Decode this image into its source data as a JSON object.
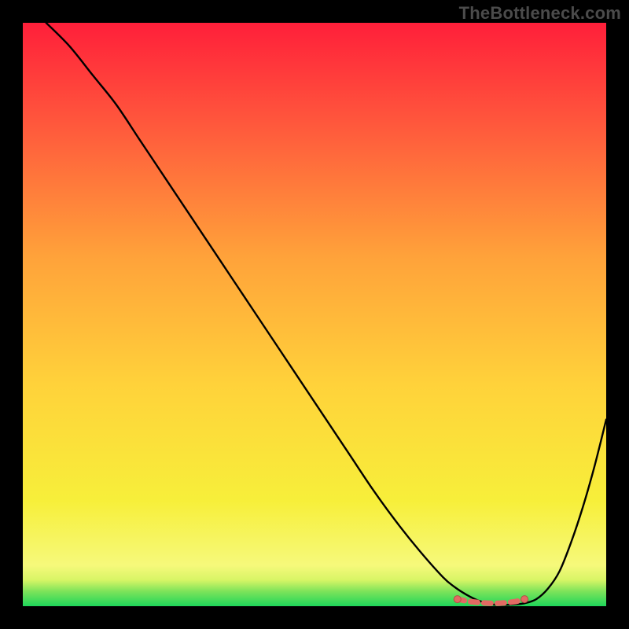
{
  "watermark": "TheBottleneck.com",
  "colors": {
    "frame": "#000000",
    "gradient_top": "#ff1f3a",
    "gradient_mid1": "#ff5a3c",
    "gradient_mid2": "#ffa23a",
    "gradient_mid3": "#ffd23a",
    "gradient_mid4": "#f7ef3a",
    "gradient_bottom_band": "#f6f97b",
    "gradient_green": "#1fd65a",
    "curve": "#000000",
    "marker_fill": "#e26a63",
    "marker_stroke": "#b84a44"
  },
  "chart_data": {
    "type": "line",
    "title": "",
    "xlabel": "",
    "ylabel": "",
    "xlim": [
      0,
      100
    ],
    "ylim": [
      0,
      100
    ],
    "series": [
      {
        "name": "bottleneck-curve",
        "x": [
          4,
          8,
          12,
          16,
          20,
          24,
          28,
          32,
          36,
          40,
          44,
          48,
          52,
          56,
          60,
          64,
          68,
          72,
          74,
          76,
          78,
          80,
          82,
          84,
          86,
          88,
          90,
          92,
          94,
          96,
          98,
          100
        ],
        "values": [
          100,
          96,
          91,
          86,
          80,
          74,
          68,
          62,
          56,
          50,
          44,
          38,
          32,
          26,
          20,
          14.5,
          9.5,
          5,
          3.3,
          2,
          1,
          0.4,
          0.2,
          0.3,
          0.5,
          1.2,
          3,
          6,
          11,
          17,
          24,
          32
        ]
      }
    ],
    "markers": {
      "name": "optimal-range",
      "x": [
        74.5,
        76.5,
        78.5,
        80,
        81.5,
        83,
        84.5,
        86
      ],
      "y": [
        1.2,
        0.8,
        0.6,
        0.5,
        0.5,
        0.6,
        0.8,
        1.2
      ]
    }
  }
}
